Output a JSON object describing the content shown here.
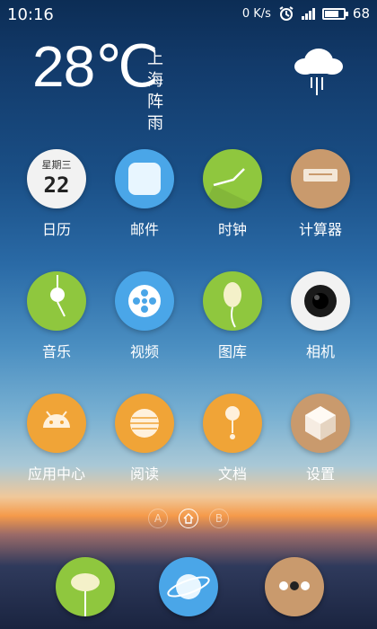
{
  "status": {
    "time": "10:16",
    "data_rate": "0 K/s",
    "battery": "68"
  },
  "weather": {
    "temp": "28℃",
    "city": "上海",
    "condition": "阵雨"
  },
  "calendar": {
    "weekday": "星期三",
    "day": "22"
  },
  "apps": [
    {
      "label": "日历",
      "icon": "calendar-icon"
    },
    {
      "label": "邮件",
      "icon": "mail-icon"
    },
    {
      "label": "时钟",
      "icon": "clock-icon"
    },
    {
      "label": "计算器",
      "icon": "calculator-icon"
    },
    {
      "label": "音乐",
      "icon": "music-icon"
    },
    {
      "label": "视频",
      "icon": "video-icon"
    },
    {
      "label": "图库",
      "icon": "gallery-icon"
    },
    {
      "label": "相机",
      "icon": "camera-icon"
    },
    {
      "label": "应用中心",
      "icon": "app-center-icon"
    },
    {
      "label": "阅读",
      "icon": "reader-icon"
    },
    {
      "label": "文档",
      "icon": "documents-icon"
    },
    {
      "label": "设置",
      "icon": "settings-icon"
    }
  ],
  "pager": {
    "a": "A",
    "b": "B"
  },
  "colors": {
    "blue": "#4aa6e8",
    "green": "#8fc73e",
    "tan": "#c99a6d",
    "orange": "#f0a437",
    "white": "#f2f2f2"
  }
}
